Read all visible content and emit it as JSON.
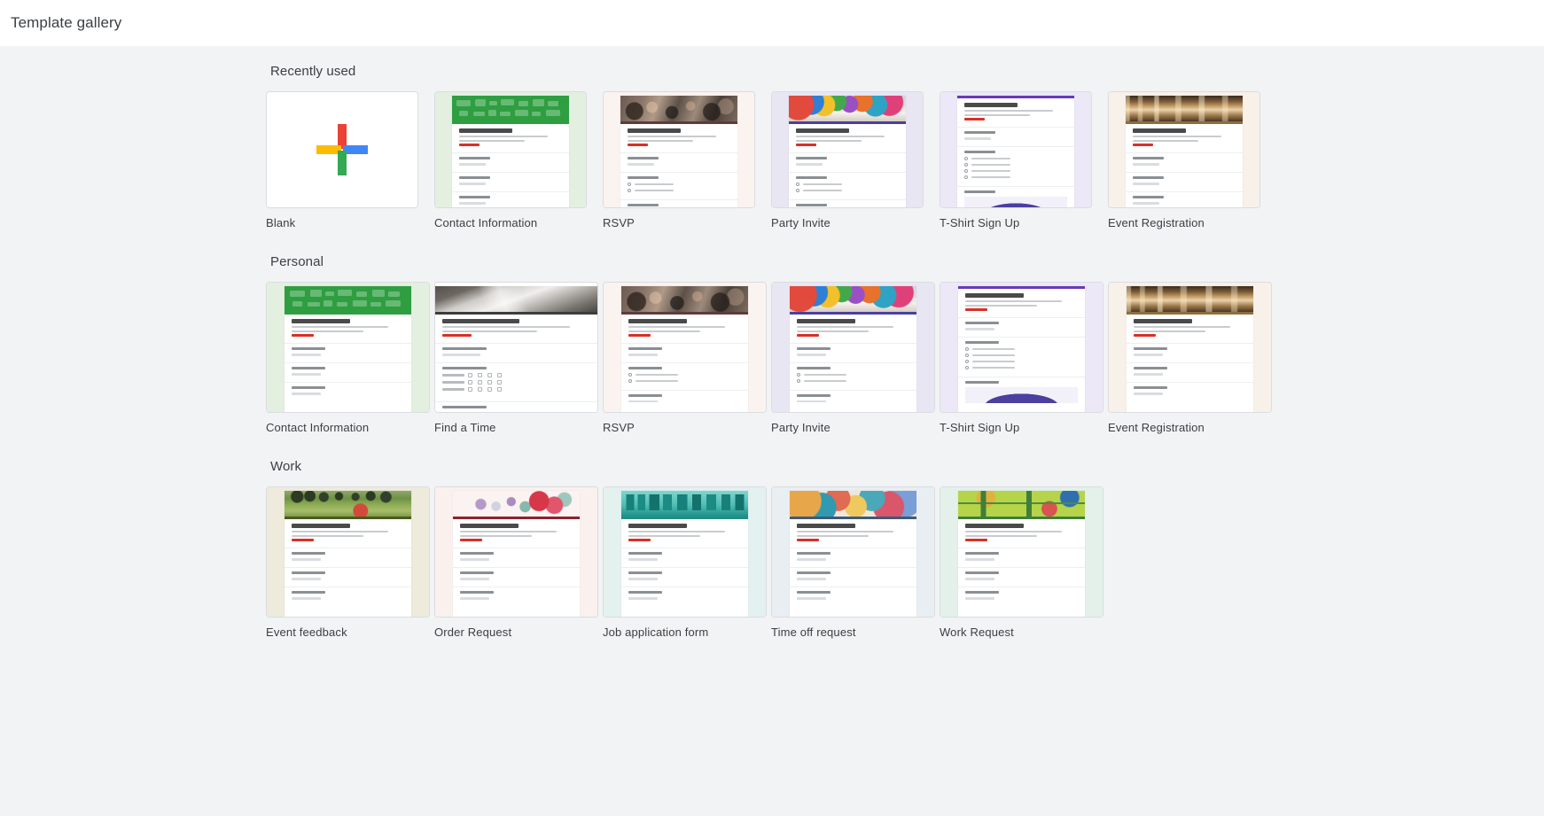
{
  "header": {
    "title": "Template gallery"
  },
  "sections": [
    {
      "id": "recently-used",
      "title": "Recently used",
      "templates": [
        {
          "label": "Blank",
          "kind": "blank",
          "bg": "#ffffff",
          "accent": "#673ab7"
        },
        {
          "label": "Contact Information",
          "kind": "form",
          "bg": "#e3f0df",
          "accent": "#2f9e41",
          "hero": "hero-green-icons",
          "title": "Contact information"
        },
        {
          "label": "RSVP",
          "kind": "form",
          "bg": "#faf3f0",
          "accent": "#5f3b3b",
          "hero": "hero-crowd",
          "title": "Event RSVP"
        },
        {
          "label": "Party Invite",
          "kind": "form",
          "bg": "#e8e6f2",
          "accent": "#4a3fa0",
          "hero": "hero-balloons",
          "title": "Party Invite"
        },
        {
          "label": "T-Shirt Sign Up",
          "kind": "form",
          "bg": "#ece8f7",
          "accent": "#673ab7",
          "hero": "",
          "title": "T-Shirt Sign Up"
        },
        {
          "label": "Event Registration",
          "kind": "form",
          "bg": "#f7f1e9",
          "accent": "#8d6e3c",
          "hero": "hero-interior",
          "title": "Event registration"
        }
      ]
    },
    {
      "id": "personal",
      "title": "Personal",
      "templates": [
        {
          "label": "Contact Information",
          "kind": "form",
          "bg": "#e3f0df",
          "accent": "#2f9e41",
          "hero": "hero-green-icons",
          "title": "Contact information"
        },
        {
          "label": "Find a Time",
          "kind": "form",
          "bg": "#ffffff",
          "accent": "#3c3c3c",
          "hero": "hero-gray-photo",
          "title": "Find a Time"
        },
        {
          "label": "RSVP",
          "kind": "form",
          "bg": "#faf3f0",
          "accent": "#5f3b3b",
          "hero": "hero-crowd",
          "title": "Event RSVP"
        },
        {
          "label": "Party Invite",
          "kind": "form",
          "bg": "#e8e6f2",
          "accent": "#4a3fa0",
          "hero": "hero-balloons",
          "title": "Party Invite"
        },
        {
          "label": "T-Shirt Sign Up",
          "kind": "form",
          "bg": "#ece8f7",
          "accent": "#673ab7",
          "hero": "",
          "title": "T-Shirt Sign Up"
        },
        {
          "label": "Event Registration",
          "kind": "form",
          "bg": "#f7f1e9",
          "accent": "#8d6e3c",
          "hero": "hero-interior",
          "title": "Event registration"
        }
      ]
    },
    {
      "id": "work",
      "title": "Work",
      "templates": [
        {
          "label": "Event feedback",
          "kind": "form",
          "bg": "#eeeadc",
          "accent": "#4a5a24",
          "hero": "hero-park",
          "title": "Event feedback"
        },
        {
          "label": "Order Request",
          "kind": "form",
          "bg": "#faf1ef",
          "accent": "#8c2230",
          "hero": "hero-floral",
          "title": "Order Request"
        },
        {
          "label": "Job application form",
          "kind": "form",
          "bg": "#e3f1ef",
          "accent": "#1f8f88",
          "hero": "hero-city",
          "title": "Job application form"
        },
        {
          "label": "Time off request",
          "kind": "form",
          "bg": "#e9eef2",
          "accent": "#3f5b76",
          "hero": "hero-watercolor",
          "title": "Time off request"
        },
        {
          "label": "Work Request",
          "kind": "form",
          "bg": "#e3f1ea",
          "accent": "#3f7f3a",
          "hero": "hero-workmap",
          "title": "Work Request"
        }
      ]
    }
  ],
  "colors": {
    "page_background": "#f1f3f4",
    "topbar_background": "#ffffff",
    "text_primary": "#3c4043",
    "card_border": "#dadce0",
    "google_red": "#ea4335",
    "google_blue": "#4285f4",
    "google_yellow": "#fbbc04",
    "google_green": "#34a853"
  }
}
